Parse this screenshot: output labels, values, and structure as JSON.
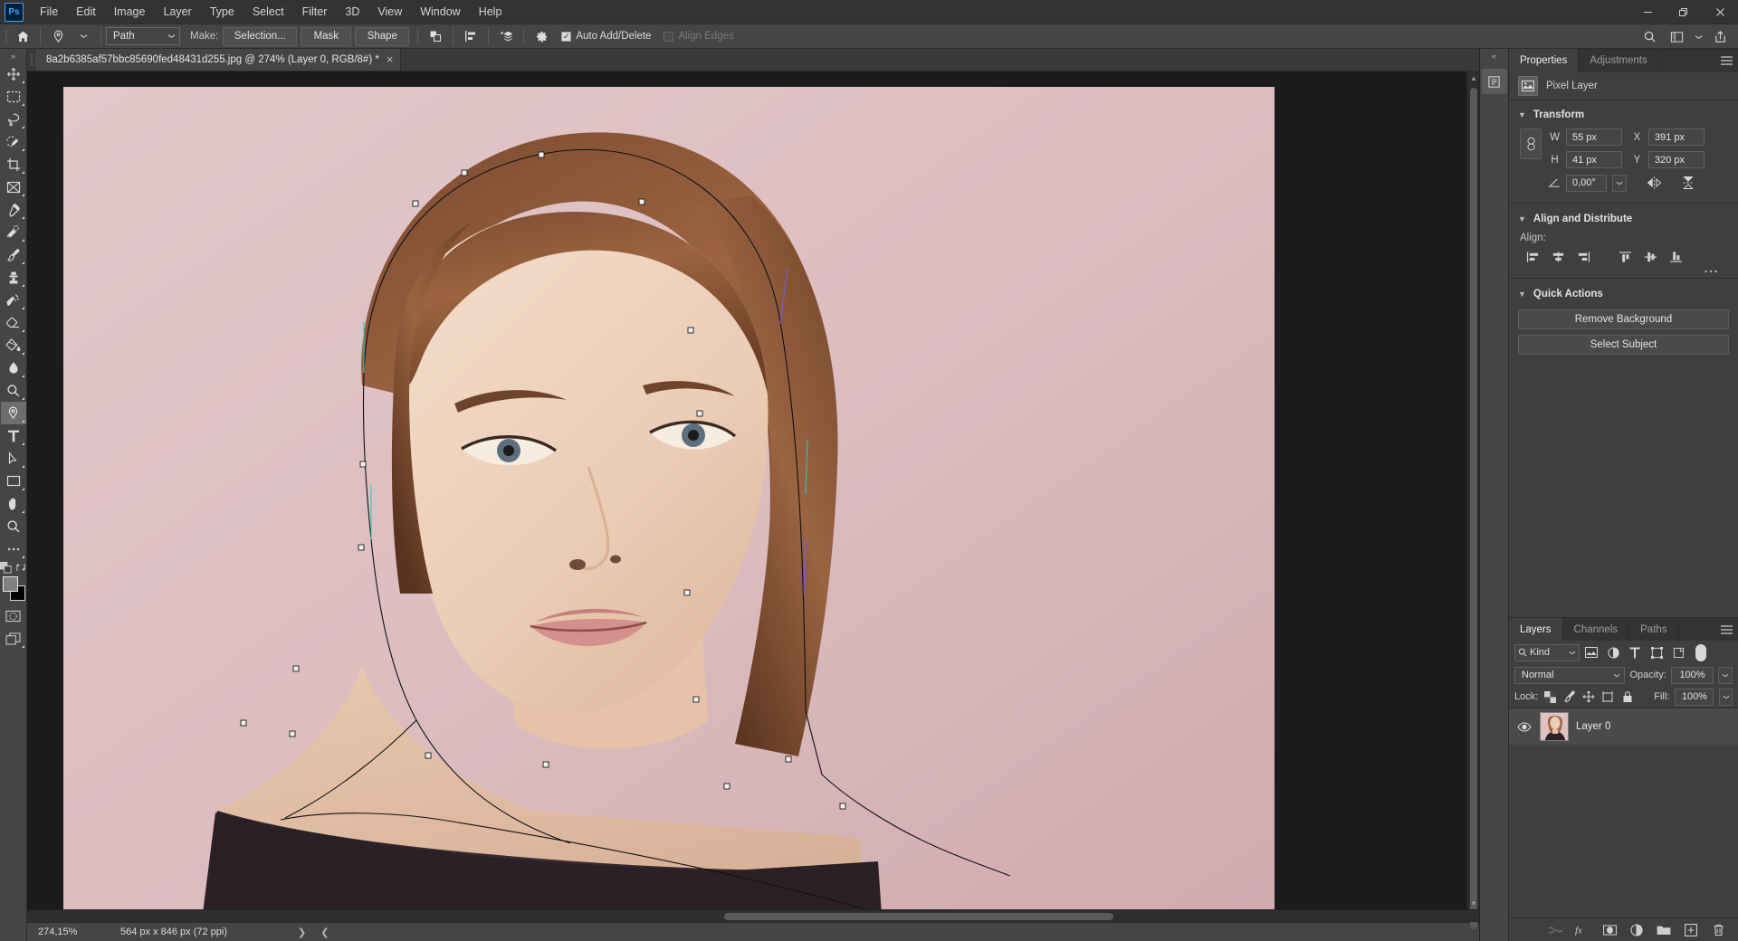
{
  "app": {
    "logo": "Ps",
    "menus": [
      "File",
      "Edit",
      "Image",
      "Layer",
      "Type",
      "Select",
      "Filter",
      "3D",
      "View",
      "Window",
      "Help"
    ],
    "window_controls": [
      "minimize",
      "restore",
      "close"
    ]
  },
  "options_bar": {
    "home_icon": "home-icon",
    "tool_icon": "pen-tool-icon",
    "mode_value": "Path",
    "make_label": "Make:",
    "buttons": [
      "Selection...",
      "Mask",
      "Shape"
    ],
    "path_operations_icon": "path-operations-icon",
    "path_alignment_icon": "path-alignment-icon",
    "path_arrangement_icon": "path-arrangement-icon",
    "gear_icon": "gear-icon",
    "auto_add_delete": {
      "label": "Auto Add/Delete",
      "checked": true
    },
    "align_edges": {
      "label": "Align Edges",
      "checked": false,
      "enabled": false
    }
  },
  "toolbar": {
    "tools": [
      {
        "name": "move-tool",
        "active": false
      },
      {
        "name": "rectangular-marquee-tool",
        "active": false
      },
      {
        "name": "lasso-tool",
        "active": false
      },
      {
        "name": "quick-selection-tool",
        "active": false
      },
      {
        "name": "crop-tool",
        "active": false
      },
      {
        "name": "frame-tool",
        "active": false
      },
      {
        "name": "eyedropper-tool",
        "active": false
      },
      {
        "name": "healing-brush-tool",
        "active": false
      },
      {
        "name": "brush-tool",
        "active": false
      },
      {
        "name": "clone-stamp-tool",
        "active": false
      },
      {
        "name": "history-brush-tool",
        "active": false
      },
      {
        "name": "eraser-tool",
        "active": false
      },
      {
        "name": "gradient-tool",
        "active": false
      },
      {
        "name": "blur-tool",
        "active": false
      },
      {
        "name": "dodge-tool",
        "active": false
      },
      {
        "name": "pen-tool",
        "active": true
      },
      {
        "name": "type-tool",
        "active": false
      },
      {
        "name": "path-selection-tool",
        "active": false
      },
      {
        "name": "rectangle-tool",
        "active": false
      },
      {
        "name": "hand-tool",
        "active": false
      },
      {
        "name": "zoom-tool",
        "active": false
      },
      {
        "name": "edit-toolbar-tool",
        "active": false
      }
    ],
    "foreground_color": "#808080",
    "background_color": "#000000"
  },
  "document": {
    "tab_title": "8a2b6385af57bbc85690fed48431d255.jpg @ 274% (Layer 0, RGB/8#) *",
    "close_icon": "close-icon",
    "canvas_background": "#d4b0b4"
  },
  "status_bar": {
    "zoom": "274,15%",
    "doc_size": "564 px x 846 px (72 ppi)",
    "expand_icon": "chevron-right-icon",
    "collapse_icon": "chevron-left-icon"
  },
  "properties_panel": {
    "tabs": [
      {
        "label": "Properties",
        "active": true
      },
      {
        "label": "Adjustments",
        "active": false
      }
    ],
    "menu_icon": "panel-menu-icon",
    "layer_kind": "Pixel Layer",
    "layer_kind_icon": "pixel-layer-icon",
    "transform": {
      "title": "Transform",
      "link_icon": "link-aspect-ratio-icon",
      "w_label": "W",
      "w_value": "55 px",
      "h_label": "H",
      "h_value": "41 px",
      "x_label": "X",
      "x_value": "391 px",
      "y_label": "Y",
      "y_value": "320 px",
      "angle_icon": "angle-icon",
      "angle_value": "0,00°",
      "flip_horizontal_icon": "flip-horizontal-icon",
      "flip_vertical_icon": "flip-vertical-icon"
    },
    "align_distribute": {
      "title": "Align and Distribute",
      "align_label": "Align:",
      "buttons": [
        "align-left-edges-icon",
        "align-horizontal-centers-icon",
        "align-right-edges-icon",
        "align-top-edges-icon",
        "align-vertical-centers-icon",
        "align-bottom-edges-icon"
      ],
      "more_icon": "more-options-icon"
    },
    "quick_actions": {
      "title": "Quick Actions",
      "buttons": [
        "Remove Background",
        "Select Subject"
      ]
    }
  },
  "layers_panel": {
    "tabs": [
      {
        "label": "Layers",
        "active": true
      },
      {
        "label": "Channels",
        "active": false
      },
      {
        "label": "Paths",
        "active": false
      }
    ],
    "menu_icon": "panel-menu-icon",
    "filter": {
      "search_icon": "search-icon",
      "kind_value": "Kind",
      "icons": [
        "filter-pixel-icon",
        "filter-adjustment-icon",
        "filter-type-icon",
        "filter-shape-icon",
        "filter-smart-object-icon"
      ],
      "toggle_icon": "filter-toggle-icon"
    },
    "blend_mode": "Normal",
    "opacity_label": "Opacity:",
    "opacity_value": "100%",
    "lock_label": "Lock:",
    "lock_icons": [
      "lock-transparent-pixels-icon",
      "lock-image-pixels-icon",
      "lock-position-icon",
      "lock-artboard-nesting-icon",
      "lock-all-icon"
    ],
    "fill_label": "Fill:",
    "fill_value": "100%",
    "layers": [
      {
        "name": "Layer 0",
        "visible": true,
        "selected": true,
        "thumbnail": "portrait-thumbnail"
      }
    ],
    "footer_icons": [
      "link-layers-icon",
      "layer-style-fx-icon",
      "add-layer-mask-icon",
      "new-adjustment-layer-icon",
      "new-group-icon",
      "new-layer-icon",
      "delete-layer-icon"
    ]
  },
  "top_right_icons": [
    "search-icon",
    "workspace-icon",
    "chevron-down-icon",
    "share-icon"
  ],
  "colors": {
    "panel_bg": "#3f3f3f",
    "chrome_bg": "#454545",
    "canvas_bg": "#1b1b1b",
    "accent": "#31a8ff"
  }
}
